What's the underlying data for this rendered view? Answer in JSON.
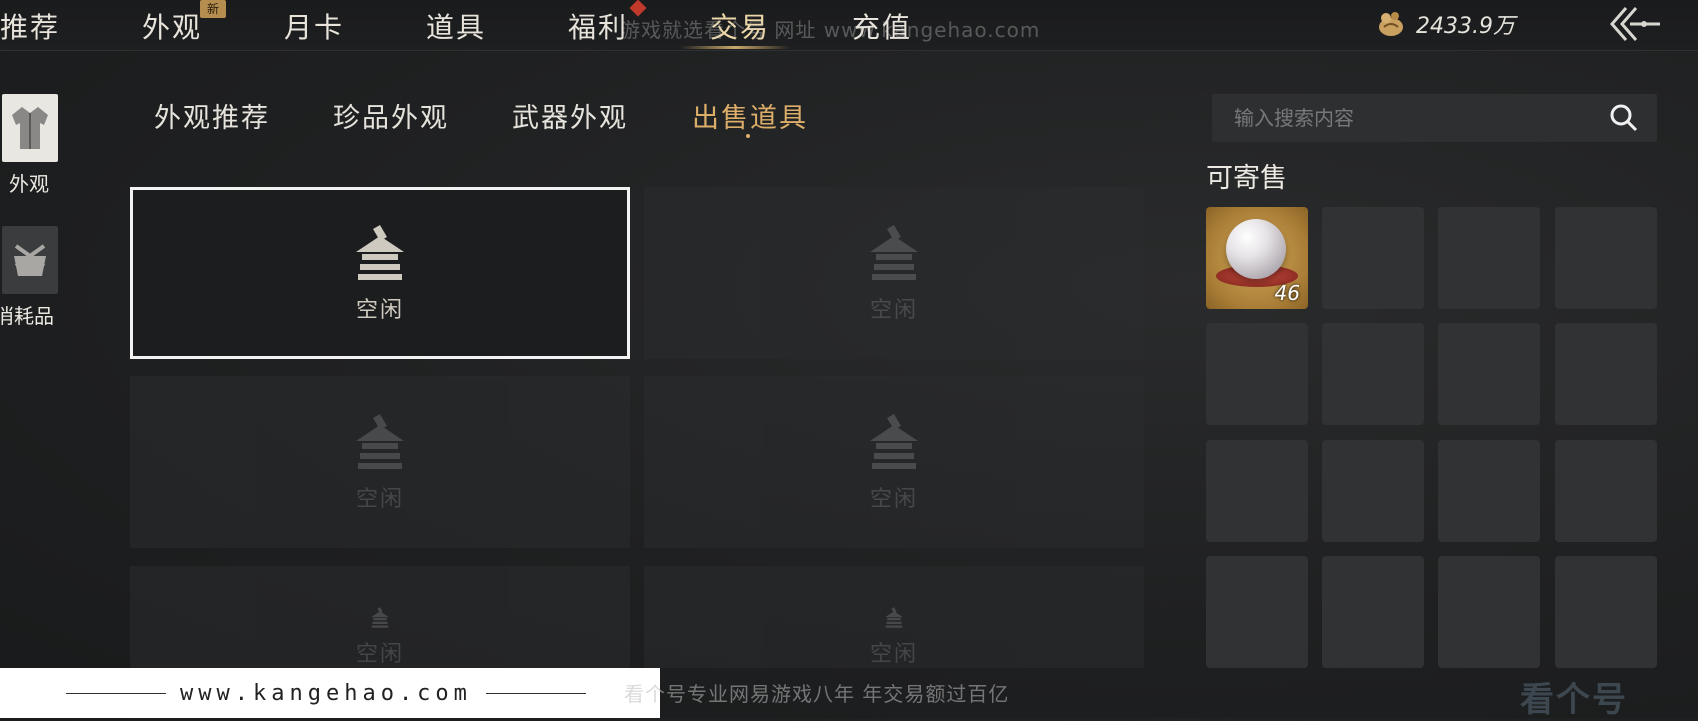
{
  "top_nav": {
    "items": [
      {
        "label": "推荐"
      },
      {
        "label": "外观",
        "badge": "新"
      },
      {
        "label": "月卡"
      },
      {
        "label": "道具"
      },
      {
        "label": "福利"
      },
      {
        "label": "交易",
        "active": true
      },
      {
        "label": "充值"
      }
    ],
    "currency": {
      "value": "2433.9万",
      "icon": "coin-pouch-icon"
    },
    "back_icon": "back-arrow-icon"
  },
  "watermark": {
    "top": "游戏就选看个号  网址 www.kangehao.com",
    "bottom_url": "www.kangehao.com",
    "bottom_slogan": "看个号专业网易游戏八年  年交易额过百亿",
    "logo": "看个号"
  },
  "sidebar": {
    "items": [
      {
        "label": "外观",
        "icon": "robe-icon",
        "selected": true
      },
      {
        "label": "消耗品",
        "icon": "bundle-icon",
        "selected": false
      }
    ]
  },
  "sub_tabs": [
    {
      "label": "外观推荐"
    },
    {
      "label": "珍品外观"
    },
    {
      "label": "武器外观"
    },
    {
      "label": "出售道具",
      "active": true
    }
  ],
  "search": {
    "placeholder": "输入搜索内容"
  },
  "slots": [
    {
      "label": "空闲",
      "selected": true
    },
    {
      "label": "空闲"
    },
    {
      "label": "空闲"
    },
    {
      "label": "空闲"
    },
    {
      "label": "空闲"
    },
    {
      "label": "空闲"
    }
  ],
  "sellable": {
    "title": "可寄售",
    "items": [
      {
        "icon": "pearl-icon",
        "quantity": "46"
      }
    ]
  },
  "colors": {
    "accent_gold": "#dcae6a",
    "background": "#1f2021",
    "slot_bg": "#2a2b2d"
  }
}
